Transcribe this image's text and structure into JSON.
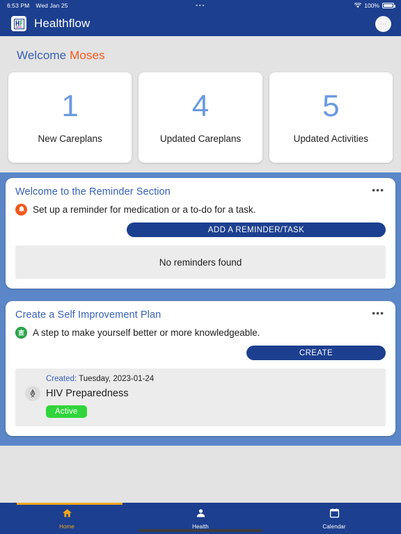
{
  "status_bar": {
    "time": "6:53 PM",
    "date": "Wed Jan 25",
    "center_dots": "•••",
    "battery_percent": "100%",
    "wifi_icon": "wifi-icon",
    "battery_icon": "battery-full-icon"
  },
  "app_bar": {
    "logo_icon": "healthflow-logo-icon",
    "title": "Healthflow",
    "avatar_initials": "···"
  },
  "welcome": {
    "greeting": "Welcome",
    "user_name": "Moses"
  },
  "stats": [
    {
      "value": "1",
      "label": "New Careplans"
    },
    {
      "value": "4",
      "label": "Updated Careplans"
    },
    {
      "value": "5",
      "label": "Updated Activities"
    }
  ],
  "reminder_card": {
    "title": "Welcome to the Reminder Section",
    "menu_label": "•••",
    "icon": "bell-icon",
    "description": "Set up a reminder for medication or a to-do for a task.",
    "button_label": "ADD A REMINDER/TASK",
    "empty_text": "No reminders found"
  },
  "plan_card": {
    "title": "Create a Self Improvement Plan",
    "menu_label": "•••",
    "icon": "graduation-badge-icon",
    "description": "A step to make yourself better or more knowledgeable.",
    "button_label": "CREATE",
    "item": {
      "created_label": "Created:",
      "created_value": "Tuesday, 2023-01-24",
      "icon": "awareness-ribbon-icon",
      "name": "HIV Preparedness",
      "status": "Active"
    }
  },
  "bottom_nav": {
    "items": [
      {
        "label": "Home",
        "icon": "home-icon",
        "active": true
      },
      {
        "label": "Health",
        "icon": "person-icon",
        "active": false
      },
      {
        "label": "Calendar",
        "icon": "calendar-icon",
        "active": false
      }
    ]
  },
  "colors": {
    "primary_blue": "#1c3f8f",
    "panel_blue": "#5b87c8",
    "link_blue": "#3761b4",
    "accent_orange": "#f4591d",
    "active_green": "#2fd53b",
    "nav_active": "#f5a61c",
    "stat_number_blue": "#6a9ae0"
  }
}
